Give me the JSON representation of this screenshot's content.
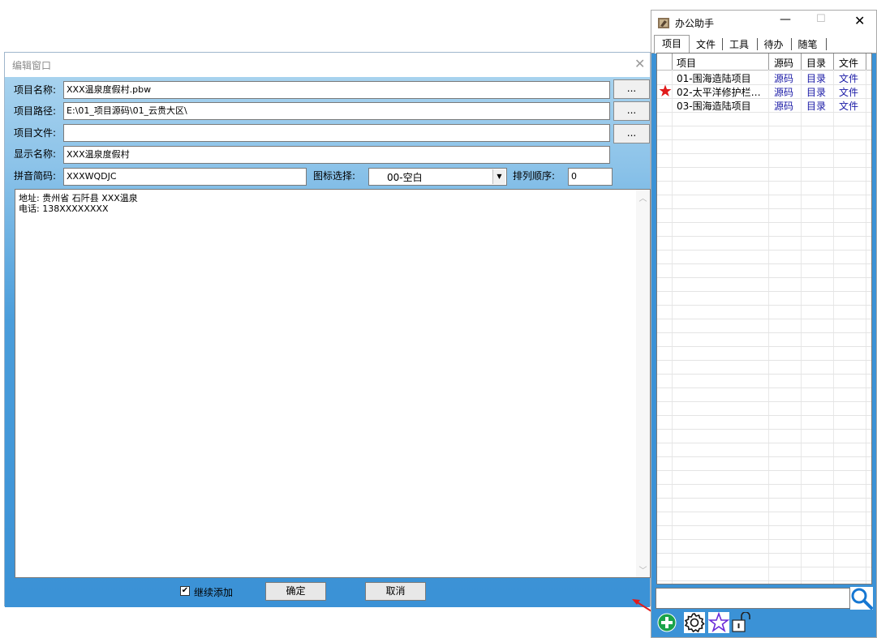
{
  "edit_window": {
    "title": "编辑窗口",
    "close_glyph": "✕",
    "fields": {
      "project_name": {
        "label": "项目名称:",
        "value": "XXX温泉度假村.pbw"
      },
      "project_path": {
        "label": "项目路径:",
        "value": "E:\\01_项目源码\\01_云贵大区\\"
      },
      "project_file": {
        "label": "项目文件:",
        "value": ""
      },
      "display_name": {
        "label": "显示名称:",
        "value": "XXX温泉度假村"
      },
      "pinyin_code": {
        "label": "拼音简码:",
        "value": "XXXWQDJC"
      },
      "icon_select": {
        "label": "图标选择:",
        "value": "00-空白"
      },
      "sort_order": {
        "label": "排列顺序:",
        "value": "0"
      }
    },
    "browse_label": "...",
    "notes": [
      "地址: 贵州省 石阡县 XXX温泉",
      "电话: 138XXXXXXXX"
    ],
    "continue_add": {
      "label": "继续添加",
      "checked": true
    },
    "ok_label": "确定",
    "cancel_label": "取消"
  },
  "assistant": {
    "title": "办公助手",
    "min_glyph": "—",
    "max_glyph": "☐",
    "close_glyph": "✕",
    "tabs": [
      "项目",
      "文件",
      "工具",
      "待办",
      "随笔"
    ],
    "active_tab": "项目",
    "columns": [
      "项目",
      "源码",
      "目录",
      "文件"
    ],
    "rows": [
      {
        "name": "01-围海造陆项目",
        "src": "源码",
        "dir": "目录",
        "file": "文件",
        "starred": false
      },
      {
        "name": "02-太平洋修护栏…",
        "src": "源码",
        "dir": "目录",
        "file": "文件",
        "starred": true
      },
      {
        "name": "03-围海造陆项目",
        "src": "源码",
        "dir": "目录",
        "file": "文件",
        "starred": false
      }
    ],
    "search_value": "",
    "icons": [
      "search-icon",
      "add-icon",
      "gear-icon",
      "star-icon",
      "lock-icon"
    ],
    "colors": {
      "accent": "#3b92d6",
      "link": "#1a1aa6",
      "star": "#e11b1b",
      "add": "#1aa34a"
    }
  }
}
